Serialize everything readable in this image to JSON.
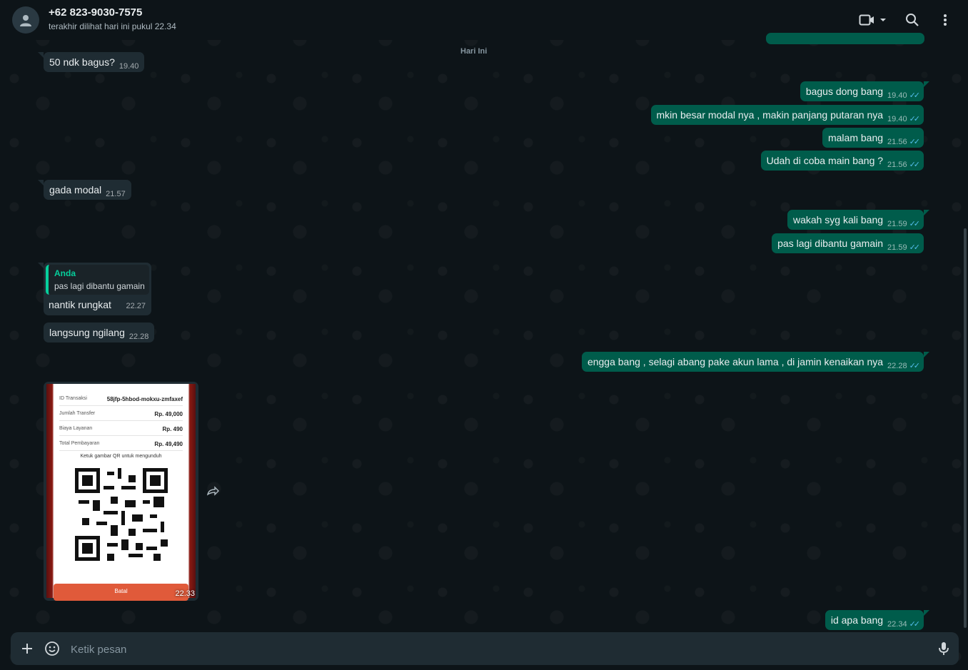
{
  "header": {
    "contact_name": "+62 823-9030-7575",
    "last_seen": "terakhir dilihat hari ini pukul 22.34"
  },
  "date_chip": "Hari Ini",
  "messages": [
    {
      "dir": "in",
      "text": "50 ndk bagus?",
      "time": "19.40"
    },
    {
      "dir": "out",
      "text": "bagus dong bang",
      "time": "19.40"
    },
    {
      "dir": "out",
      "text": "mkin besar modal nya , makin panjang putaran nya",
      "time": "19.40"
    },
    {
      "dir": "out",
      "text": "malam bang",
      "time": "21.56"
    },
    {
      "dir": "out",
      "text": "Udah di coba main bang ?",
      "time": "21.56"
    },
    {
      "dir": "in",
      "text": "gada modal",
      "time": "21.57"
    },
    {
      "dir": "out",
      "text": "wakah syg kali bang",
      "time": "21.59"
    },
    {
      "dir": "out",
      "text": "pas lagi dibantu gamain",
      "time": "21.59"
    },
    {
      "dir": "in",
      "text": "nantik rungkat",
      "time": "22.27",
      "quote": {
        "author": "Anda",
        "text": "pas lagi dibantu gamain"
      }
    },
    {
      "dir": "in",
      "text": "langsung ngilang",
      "time": "22.28"
    },
    {
      "dir": "out",
      "text": "engga bang , selagi abang pake akun lama , di jamin kenaikan nya",
      "time": "22.28"
    },
    {
      "dir": "in",
      "type": "image",
      "time": "22.33"
    },
    {
      "dir": "out",
      "text": "id apa bang",
      "time": "22.34"
    }
  ],
  "receipt": {
    "rows": [
      {
        "label": "ID Transaksi",
        "value": "58jfp-5hbod-mokxu-zmfaxef"
      },
      {
        "label": "Jumlah Transfer",
        "value": "Rp. 49,000"
      },
      {
        "label": "Biaya Layanan",
        "value": "Rp. 490"
      },
      {
        "label": "Total Pembayaran",
        "value": "Rp. 49,490"
      }
    ],
    "qr_hint": "Ketuk gambar QR untuk mengunduh",
    "cancel_label": "Batal"
  },
  "composer": {
    "placeholder": "Ketik pesan"
  },
  "icons": {
    "avatar": "person-icon",
    "video": "video-call-icon",
    "search": "search-icon",
    "menu": "kebab-menu-icon",
    "attach": "plus-icon",
    "sticker": "sticker-icon",
    "mic": "microphone-icon",
    "forward": "forward-icon",
    "read": "double-check-icon"
  },
  "colors": {
    "outgoing": "#005c4b",
    "incoming": "#1f2c33",
    "accent": "#06cf9c",
    "read_tick": "#53bdeb"
  }
}
